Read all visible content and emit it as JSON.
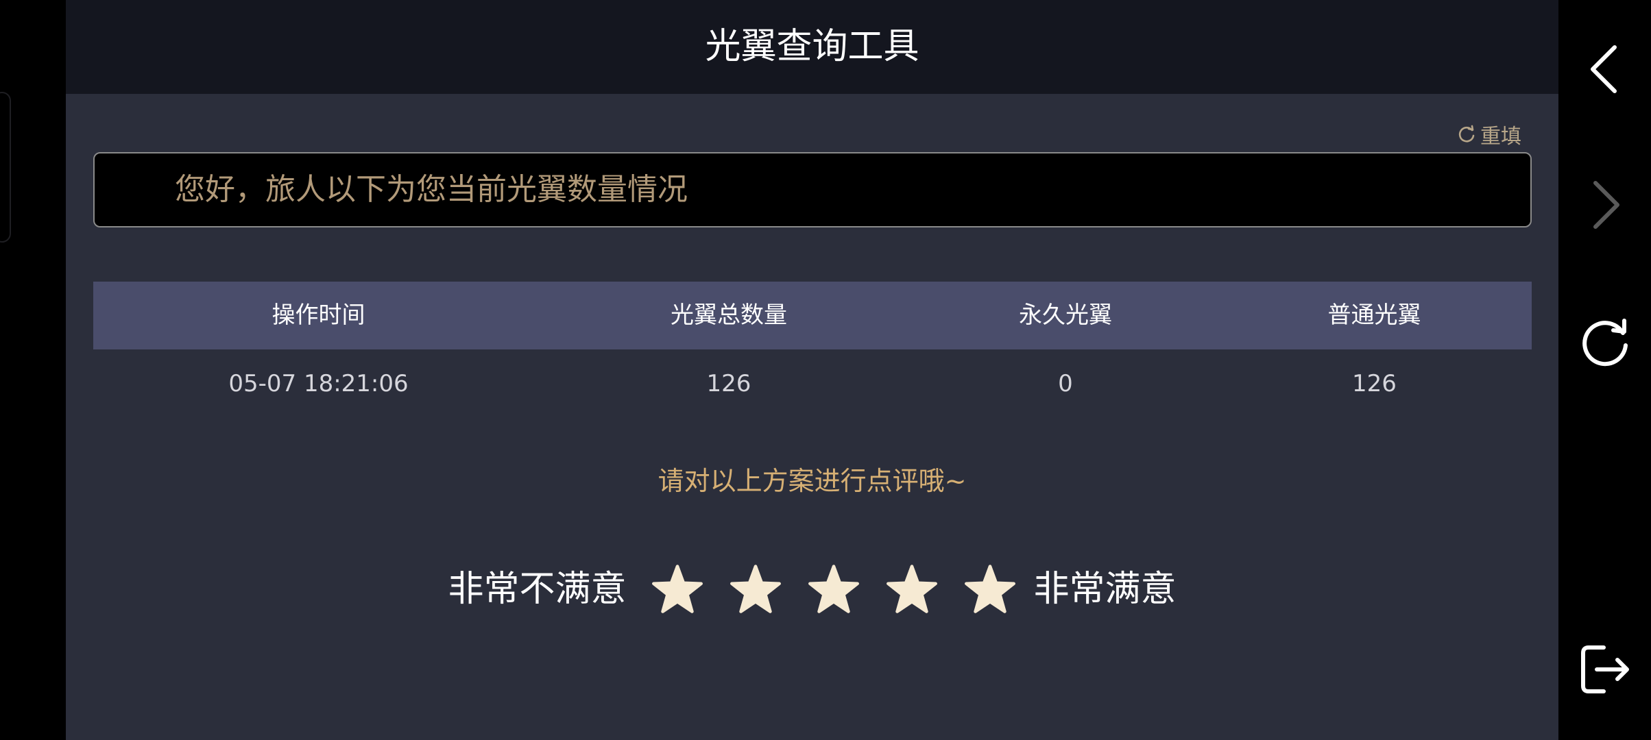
{
  "header": {
    "title": "光翼查询工具"
  },
  "reset": {
    "label": "重填",
    "icon": "refresh-icon"
  },
  "message": {
    "text": "您好，旅人以下为您当前光翼数量情况"
  },
  "table": {
    "headers": [
      "操作时间",
      "光翼总数量",
      "永久光翼",
      "普通光翼"
    ],
    "rows": [
      [
        "05-07 18:21:06",
        "126",
        "0",
        "126"
      ]
    ]
  },
  "rating": {
    "prompt": "请对以上方案进行点评哦~",
    "low_label": "非常不满意",
    "high_label": "非常满意",
    "star_count": 5,
    "star_color": "#f6ead3"
  },
  "side_nav": {
    "items": [
      "back-icon",
      "forward-icon",
      "reload-icon",
      "exit-icon"
    ]
  },
  "colors": {
    "header_bg": "#14161f",
    "panel_bg": "#2b2e3b",
    "table_head_bg": "#4a4d6b",
    "accent_gold": "#d7b074",
    "message_text": "#b29a79"
  }
}
